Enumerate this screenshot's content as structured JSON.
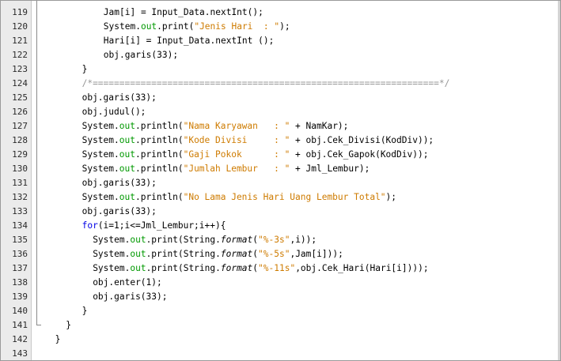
{
  "editor": {
    "lines": [
      {
        "n": "119",
        "indent": 11,
        "tokens": [
          {
            "t": "Jam[i] = Input_Data.nextInt();",
            "c": ""
          }
        ]
      },
      {
        "n": "120",
        "indent": 11,
        "tokens": [
          {
            "t": "System.",
            "c": ""
          },
          {
            "t": "out",
            "c": "field"
          },
          {
            "t": ".print(",
            "c": ""
          },
          {
            "t": "\"Jenis Hari  : \"",
            "c": "str"
          },
          {
            "t": ");",
            "c": ""
          }
        ]
      },
      {
        "n": "121",
        "indent": 11,
        "tokens": [
          {
            "t": "Hari[i] = Input_Data.nextInt ();",
            "c": ""
          }
        ]
      },
      {
        "n": "122",
        "indent": 11,
        "tokens": [
          {
            "t": "obj.garis(33);",
            "c": ""
          }
        ]
      },
      {
        "n": "123",
        "indent": 7,
        "tokens": [
          {
            "t": "}",
            "c": ""
          }
        ]
      },
      {
        "n": "124",
        "indent": 7,
        "tokens": [
          {
            "t": "/*=================================================================*/",
            "c": "cmt"
          }
        ]
      },
      {
        "n": "125",
        "indent": 7,
        "tokens": [
          {
            "t": "obj.garis(33);",
            "c": ""
          }
        ]
      },
      {
        "n": "126",
        "indent": 7,
        "tokens": [
          {
            "t": "obj.judul();",
            "c": ""
          }
        ]
      },
      {
        "n": "127",
        "indent": 7,
        "tokens": [
          {
            "t": "System.",
            "c": ""
          },
          {
            "t": "out",
            "c": "field"
          },
          {
            "t": ".println(",
            "c": ""
          },
          {
            "t": "\"Nama Karyawan   : \"",
            "c": "str"
          },
          {
            "t": " + NamKar);",
            "c": ""
          }
        ]
      },
      {
        "n": "128",
        "indent": 7,
        "tokens": [
          {
            "t": "System.",
            "c": ""
          },
          {
            "t": "out",
            "c": "field"
          },
          {
            "t": ".println(",
            "c": ""
          },
          {
            "t": "\"Kode Divisi     : \"",
            "c": "str"
          },
          {
            "t": " + obj.Cek_Divisi(KodDiv));",
            "c": ""
          }
        ]
      },
      {
        "n": "129",
        "indent": 7,
        "tokens": [
          {
            "t": "System.",
            "c": ""
          },
          {
            "t": "out",
            "c": "field"
          },
          {
            "t": ".println(",
            "c": ""
          },
          {
            "t": "\"Gaji Pokok      : \"",
            "c": "str"
          },
          {
            "t": " + obj.Cek_Gapok(KodDiv));",
            "c": ""
          }
        ]
      },
      {
        "n": "130",
        "indent": 7,
        "tokens": [
          {
            "t": "System.",
            "c": ""
          },
          {
            "t": "out",
            "c": "field"
          },
          {
            "t": ".println(",
            "c": ""
          },
          {
            "t": "\"Jumlah Lembur   : \"",
            "c": "str"
          },
          {
            "t": " + Jml_Lembur);",
            "c": ""
          }
        ]
      },
      {
        "n": "131",
        "indent": 7,
        "tokens": [
          {
            "t": "obj.garis(33);",
            "c": ""
          }
        ]
      },
      {
        "n": "132",
        "indent": 7,
        "tokens": [
          {
            "t": "System.",
            "c": ""
          },
          {
            "t": "out",
            "c": "field"
          },
          {
            "t": ".println(",
            "c": ""
          },
          {
            "t": "\"No Lama Jenis Hari Uang Lembur Total\"",
            "c": "str"
          },
          {
            "t": ");",
            "c": ""
          }
        ]
      },
      {
        "n": "133",
        "indent": 7,
        "tokens": [
          {
            "t": "obj.garis(33);",
            "c": ""
          }
        ]
      },
      {
        "n": "134",
        "indent": 7,
        "tokens": [
          {
            "t": "for",
            "c": "kw"
          },
          {
            "t": "(i=1;i<=Jml_Lembur;i++){",
            "c": ""
          }
        ]
      },
      {
        "n": "135",
        "indent": 9,
        "tokens": [
          {
            "t": "System.",
            "c": ""
          },
          {
            "t": "out",
            "c": "field"
          },
          {
            "t": ".print(String.",
            "c": ""
          },
          {
            "t": "format",
            "c": "italic"
          },
          {
            "t": "(",
            "c": ""
          },
          {
            "t": "\"%-3s\"",
            "c": "str"
          },
          {
            "t": ",i));",
            "c": ""
          }
        ]
      },
      {
        "n": "136",
        "indent": 9,
        "tokens": [
          {
            "t": "System.",
            "c": ""
          },
          {
            "t": "out",
            "c": "field"
          },
          {
            "t": ".print(String.",
            "c": ""
          },
          {
            "t": "format",
            "c": "italic"
          },
          {
            "t": "(",
            "c": ""
          },
          {
            "t": "\"%-5s\"",
            "c": "str"
          },
          {
            "t": ",Jam[i]));",
            "c": ""
          }
        ]
      },
      {
        "n": "137",
        "indent": 9,
        "tokens": [
          {
            "t": "System.",
            "c": ""
          },
          {
            "t": "out",
            "c": "field"
          },
          {
            "t": ".print(String.",
            "c": ""
          },
          {
            "t": "format",
            "c": "italic"
          },
          {
            "t": "(",
            "c": ""
          },
          {
            "t": "\"%-11s\"",
            "c": "str"
          },
          {
            "t": ",obj.Cek_Hari(Hari[i])));",
            "c": ""
          }
        ]
      },
      {
        "n": "138",
        "indent": 9,
        "tokens": [
          {
            "t": "obj.enter(1);",
            "c": ""
          }
        ]
      },
      {
        "n": "139",
        "indent": 9,
        "tokens": [
          {
            "t": "obj.garis(33);",
            "c": ""
          }
        ]
      },
      {
        "n": "140",
        "indent": 7,
        "tokens": [
          {
            "t": "}",
            "c": ""
          }
        ]
      },
      {
        "n": "141",
        "indent": 4,
        "tokens": [
          {
            "t": "}",
            "c": ""
          }
        ]
      },
      {
        "n": "142",
        "indent": 2,
        "tokens": [
          {
            "t": "}",
            "c": ""
          }
        ]
      },
      {
        "n": "143",
        "indent": 0,
        "tokens": []
      }
    ],
    "colors": {
      "keyword": "#0000e6",
      "field": "#009900",
      "string": "#ce7b00",
      "comment": "#969696"
    }
  }
}
